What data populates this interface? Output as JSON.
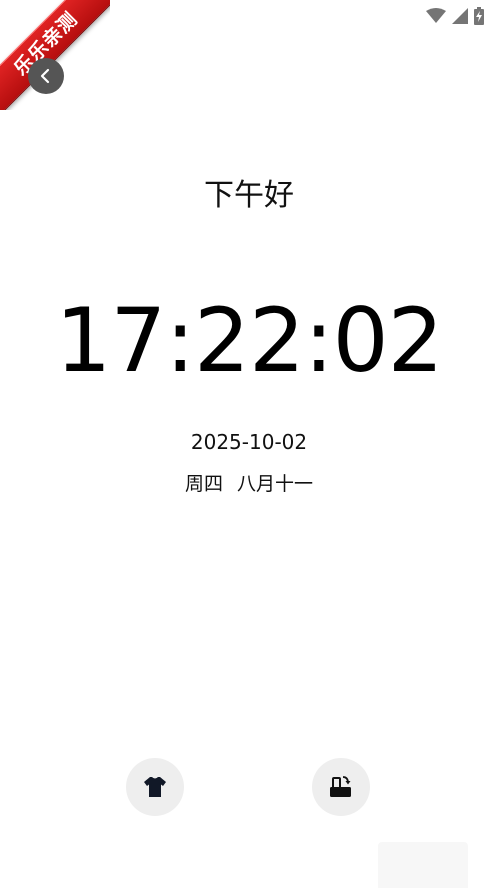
{
  "ribbon": {
    "label": "乐乐亲测"
  },
  "greeting": "下午好",
  "clock": {
    "time": "17:22:02"
  },
  "date": {
    "gregorian": "2025-10-02",
    "weekday": "周四",
    "lunar": "八月十一"
  },
  "icons": {
    "back": "chevron-left-icon",
    "theme": "tshirt-icon",
    "rotate": "rotate-screen-icon",
    "wifi": "wifi-icon",
    "signal": "signal-icon",
    "battery": "battery-icon"
  },
  "colors": {
    "ribbon": "#d11a1a",
    "back_button_bg": "#555555",
    "round_button_bg": "#eeeeee",
    "text": "#000000"
  }
}
